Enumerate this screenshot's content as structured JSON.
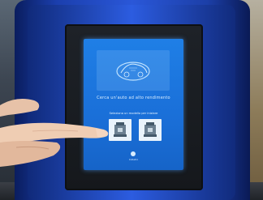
{
  "screen": {
    "title": "Cerca un'auto ad alto rendimento",
    "prompt": "Seleziona un modello per iniziare",
    "dot_label": "Indietro"
  },
  "colors": {
    "kiosk_blue": "#2a57d8",
    "screen_blue": "#1f7fe6",
    "bezel": "#1e2228"
  }
}
